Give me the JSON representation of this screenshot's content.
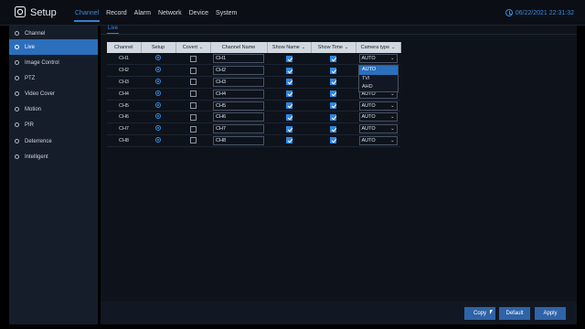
{
  "app": {
    "title": "Setup",
    "datetime": "06/22/2021 22:31:32",
    "nav": [
      "Channel",
      "Record",
      "Alarm",
      "Network",
      "Device",
      "System"
    ],
    "active_nav": "Channel",
    "accent": "#2f7fd1"
  },
  "sidebar": {
    "items": [
      {
        "label": "Channel",
        "icon": "channel-icon"
      },
      {
        "label": "Live",
        "icon": "live-icon",
        "active": true
      },
      {
        "label": "Image Control",
        "icon": "image-control-icon"
      },
      {
        "label": "PTZ",
        "icon": "ptz-icon"
      },
      {
        "label": "Video Cover",
        "icon": "video-cover-icon"
      },
      {
        "label": "Motion",
        "icon": "motion-icon"
      },
      {
        "label": "PIR",
        "icon": "pir-icon"
      },
      {
        "label": "Deterrence",
        "icon": "deterrence-icon"
      },
      {
        "label": "Intelligent",
        "icon": "intelligent-icon"
      }
    ]
  },
  "subtab": {
    "label": "Live"
  },
  "table": {
    "headers": [
      "Channel",
      "Setup",
      "Covert",
      "Channel Name",
      "Show Name",
      "Show Time",
      "Camera type"
    ],
    "rows": [
      {
        "channel": "CH1",
        "name": "CH1",
        "covert": false,
        "show_name": true,
        "show_time": true,
        "camera_type": "AUTO"
      },
      {
        "channel": "CH2",
        "name": "CH2",
        "covert": false,
        "show_name": true,
        "show_time": true,
        "camera_type": "AUTO"
      },
      {
        "channel": "CH3",
        "name": "CH3",
        "covert": false,
        "show_name": true,
        "show_time": true,
        "camera_type": "AUTO"
      },
      {
        "channel": "CH4",
        "name": "CH4",
        "covert": false,
        "show_name": true,
        "show_time": true,
        "camera_type": "AUTO"
      },
      {
        "channel": "CH5",
        "name": "CH5",
        "covert": false,
        "show_name": true,
        "show_time": true,
        "camera_type": "AUTO"
      },
      {
        "channel": "CH6",
        "name": "CH6",
        "covert": false,
        "show_name": true,
        "show_time": true,
        "camera_type": "AUTO"
      },
      {
        "channel": "CH7",
        "name": "CH7",
        "covert": false,
        "show_name": true,
        "show_time": true,
        "camera_type": "AUTO"
      },
      {
        "channel": "CH8",
        "name": "CH8",
        "covert": false,
        "show_name": true,
        "show_time": true,
        "camera_type": "AUTO"
      }
    ]
  },
  "camera_type_dropdown": {
    "options": [
      "AUTO",
      "TVI",
      "AHD"
    ],
    "highlighted": "AUTO"
  },
  "buttons": {
    "copy": "Copy",
    "default": "Default",
    "apply": "Apply"
  }
}
